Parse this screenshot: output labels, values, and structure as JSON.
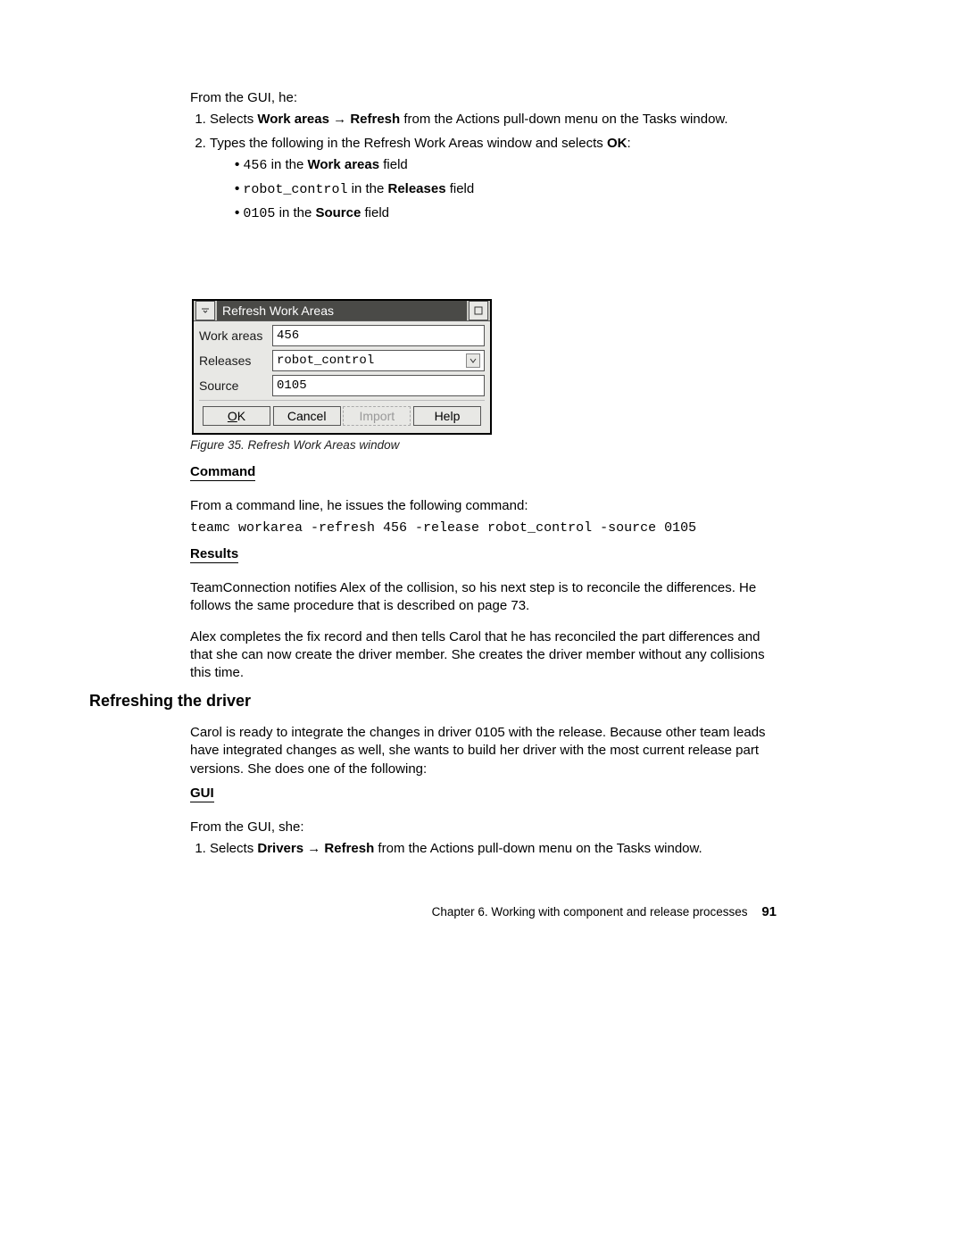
{
  "intro_line": "From the GUI, he:",
  "step1_pre": "Selects ",
  "step1_b1": "Work areas",
  "step1_arrow": " → ",
  "step1_b2": "Refresh",
  "step1_post": " from the Actions pull-down menu on the Tasks window.",
  "step2_pre": "Types the following in the Refresh Work Areas window and selects ",
  "step2_b": "OK",
  "step2_post": ":",
  "bul1_code": "456",
  "bul1_mid": " in the ",
  "bul1_b": "Work areas",
  "bul1_end": " field",
  "bul2_code": "robot_control",
  "bul2_mid": " in the ",
  "bul2_b": "Releases",
  "bul2_end": " field",
  "bul3_code": "0105",
  "bul3_mid": " in the ",
  "bul3_b": "Source",
  "bul3_end": " field",
  "dialog": {
    "title": "Refresh Work Areas",
    "label_workareas": "Work areas",
    "value_workareas": "456",
    "label_releases": "Releases",
    "value_releases": "robot_control",
    "label_source": "Source",
    "value_source": "0105",
    "btn_ok_u": "O",
    "btn_ok_rest": "K",
    "btn_cancel": "Cancel",
    "btn_import": "Import",
    "btn_help": "Help"
  },
  "figure_caption": "Figure 35. Refresh Work Areas window",
  "command_heading": "Command",
  "command_intro": "From a command line, he issues the following command:",
  "command_code": "teamc workarea -refresh 456 -release robot_control -source 0105",
  "results_heading": "Results",
  "results_p1": "TeamConnection notifies Alex of the collision, so his next step is to reconcile the differences. He follows the same procedure that is described on page 73.",
  "results_p2": "Alex completes the fix record and then tells Carol that he has reconciled the part differences and that she can now create the driver member. She creates the driver member without any collisions this time.",
  "h2": "Refreshing the driver",
  "refresh_p": "Carol is ready to integrate the changes in driver 0105 with the release. Because other team leads have integrated changes as well, she wants to build her driver with the most current release part versions. She does one of the following:",
  "gui2_heading": "GUI",
  "gui2_intro": "From the GUI, she:",
  "gui2_step1_pre": "Selects ",
  "gui2_step1_b1": "Drivers",
  "gui2_step1_arrow": " → ",
  "gui2_step1_b2": "Refresh",
  "gui2_step1_post": " from the Actions pull-down menu on the Tasks window.",
  "footer_text": "Chapter 6. Working with component and release processes",
  "footer_page": "91"
}
